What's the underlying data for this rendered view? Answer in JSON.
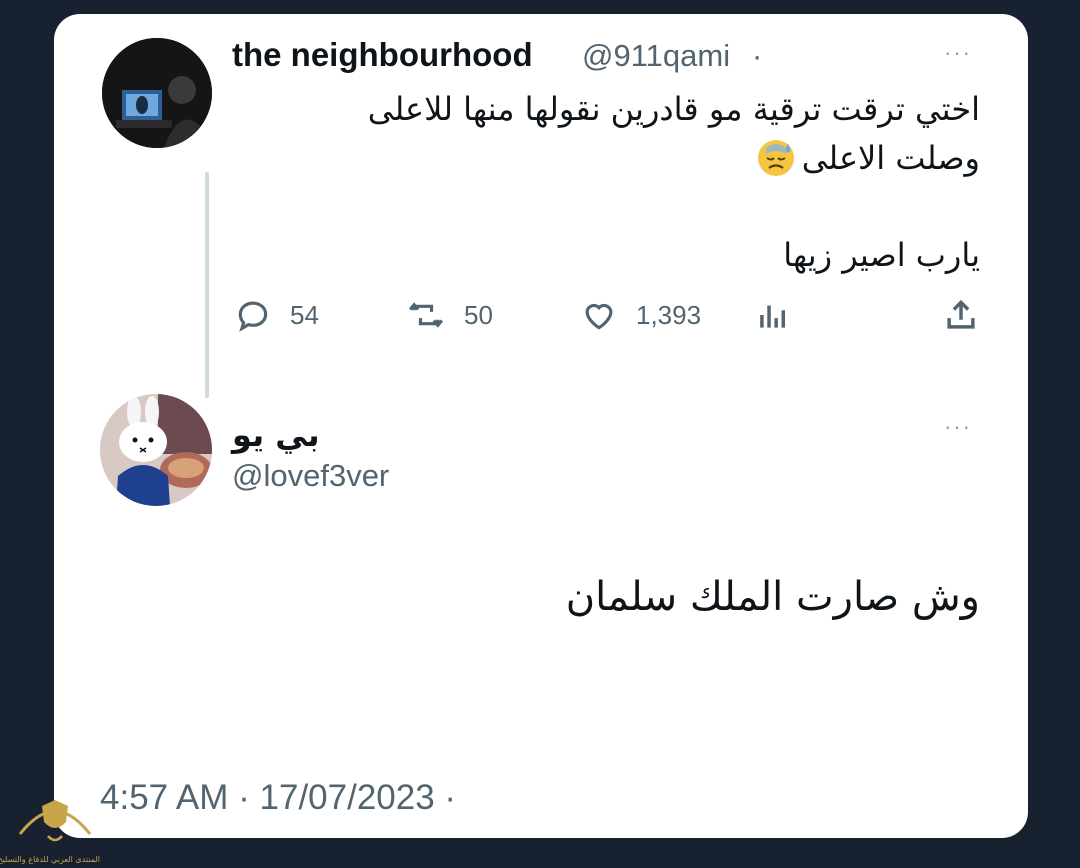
{
  "original_tweet": {
    "name": "the neighbourhood",
    "handle": "@911qami",
    "separator": "·",
    "more": "···",
    "text_line1": "اختي ترقت ترقية مو قادرين نقولها منها للاعلى",
    "text_line2": "وصلت الاعلى",
    "emoji": "😓",
    "text_line3": "يارب اصير زيها",
    "stats": {
      "replies": "54",
      "retweets": "50",
      "likes": "1,393"
    }
  },
  "reply_tweet": {
    "name": "بي يو",
    "handle": "@lovef3ver",
    "more": "···",
    "text": "وش صارت الملك سلمان",
    "timestamp": "4:57 AM · 17/07/2023 ·"
  },
  "watermark": {
    "text": "المنتدى العربي للدفاع والتسليح"
  },
  "colors": {
    "background": "#172130",
    "card": "#ffffff",
    "text": "#0f1419",
    "secondary": "#536471"
  }
}
